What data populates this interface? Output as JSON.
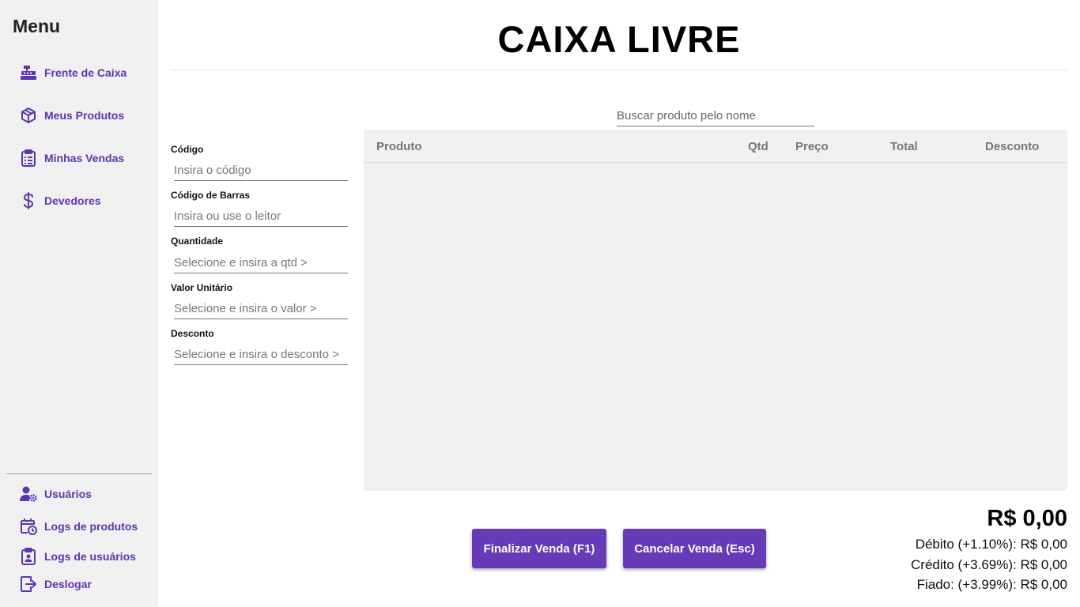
{
  "sidebar": {
    "title": "Menu",
    "items": [
      {
        "label": "Frente de Caixa",
        "icon": "cash-register-icon"
      },
      {
        "label": "Meus Produtos",
        "icon": "box-icon"
      },
      {
        "label": "Minhas Vendas",
        "icon": "clipboard-list-icon"
      },
      {
        "label": "Devedores",
        "icon": "dollar-icon"
      }
    ],
    "bottom_items": [
      {
        "label": "Usuários",
        "icon": "user-cog-icon"
      },
      {
        "label": "Logs de produtos",
        "icon": "calendar-clock-icon"
      },
      {
        "label": "Logs de usuários",
        "icon": "clipboard-user-icon"
      },
      {
        "label": "Deslogar",
        "icon": "logout-icon"
      }
    ]
  },
  "header": {
    "title": "CAIXA LIVRE"
  },
  "search": {
    "placeholder": "Buscar produto pelo nome"
  },
  "form": {
    "codigo": {
      "label": "Código",
      "placeholder": "Insira o código"
    },
    "codigo_barras": {
      "label": "Código de Barras",
      "placeholder": "Insira ou use o leitor"
    },
    "quantidade": {
      "label": "Quantidade",
      "placeholder": "Selecione e insira a qtd >"
    },
    "valor_unitario": {
      "label": "Valor Unitário",
      "placeholder": "Selecione e insira o valor >"
    },
    "desconto": {
      "label": "Desconto",
      "placeholder": "Selecione e insira o desconto >"
    }
  },
  "table": {
    "columns": [
      "Produto",
      "Qtd",
      "Preço",
      "Total",
      "Desconto"
    ],
    "rows": []
  },
  "actions": {
    "finalize_label": "Finalizar Venda (F1)",
    "cancel_label": "Cancelar Venda (Esc)"
  },
  "summary": {
    "total": "R$ 0,00",
    "debito": "Débito (+1.10%): R$ 0,00",
    "credito": "Crédito (+3.69%): R$ 0,00",
    "fiado": "Fiado: (+3.99%): R$ 0,00"
  },
  "colors": {
    "accent": "#673ab7",
    "sidebar_bg": "#f0f0f0",
    "table_bg": "#f0f0f0"
  }
}
